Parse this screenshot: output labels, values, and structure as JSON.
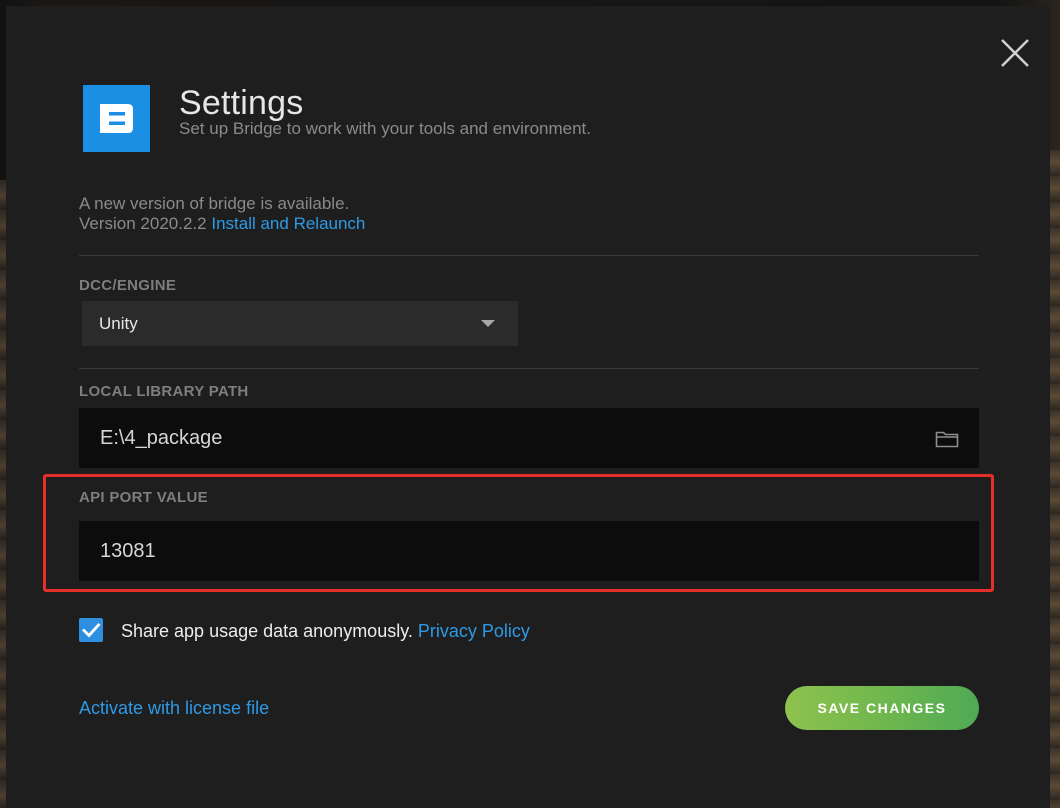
{
  "dialog": {
    "title": "Settings",
    "subtitle": "Set up Bridge to work with your tools and environment.",
    "close_icon": "close-icon",
    "logo_icon": "bridge-logo-icon",
    "accent_color": "#1a8fe3"
  },
  "update": {
    "message": "A new version of bridge is available.",
    "version_text": "Version 2020.2.2",
    "action_link": "Install and Relaunch"
  },
  "dcc_engine": {
    "label": "DCC/ENGINE",
    "selected": "Unity",
    "dropdown_icon": "caret-down-icon"
  },
  "local_library": {
    "label": "LOCAL LIBRARY PATH",
    "value": "E:\\4_package",
    "browse_icon": "folder-icon"
  },
  "api_port": {
    "label": "API PORT VALUE",
    "value": "13081",
    "highlight_color": "#e5302a"
  },
  "usage_sharing": {
    "checked": true,
    "label": "Share app usage data anonymously.",
    "policy_link": "Privacy Policy",
    "check_icon": "checkmark-icon"
  },
  "footer": {
    "activate_link": "Activate with license file",
    "save_label": "SAVE CHANGES",
    "save_color": "#6cb64e"
  }
}
